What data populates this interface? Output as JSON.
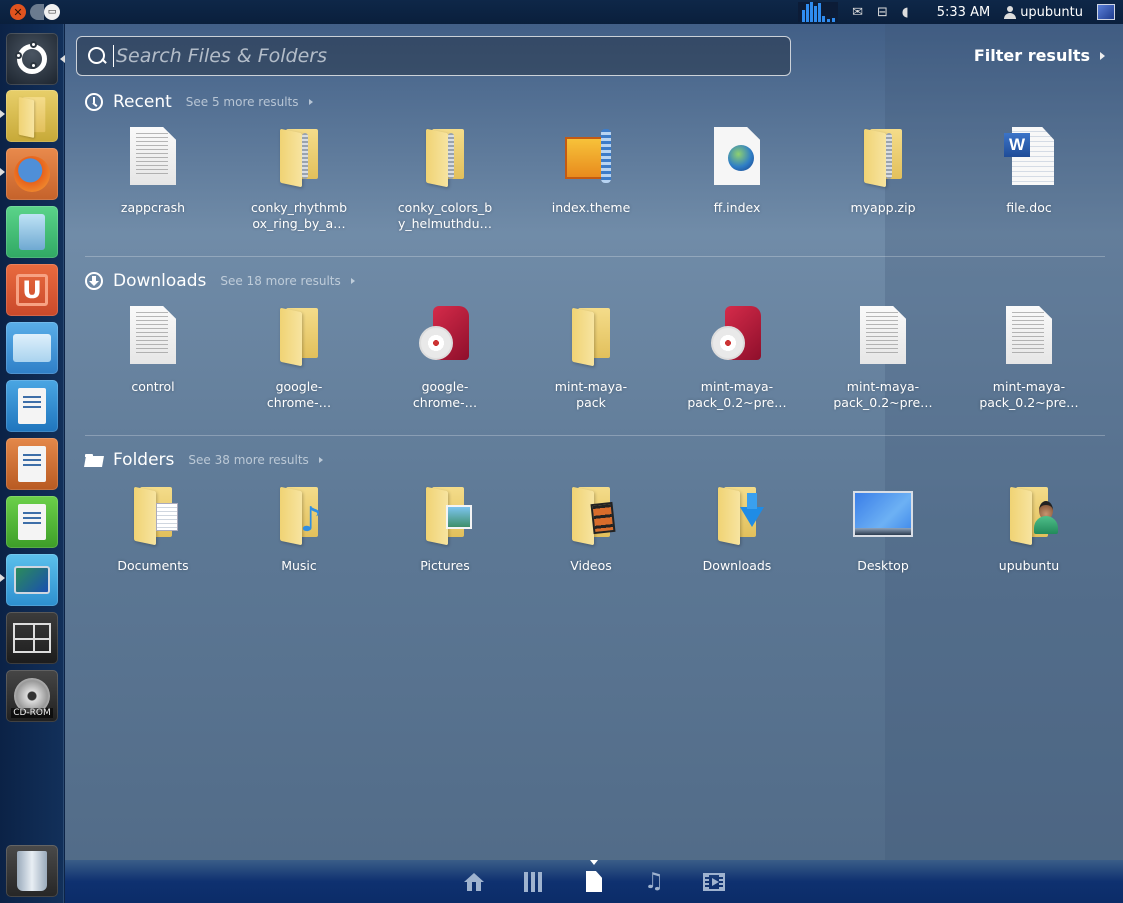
{
  "top_panel": {
    "window_controls": [
      {
        "name": "close",
        "glyph": "✕"
      },
      {
        "name": "minimize",
        "glyph": ""
      },
      {
        "name": "maximize",
        "glyph": "▭"
      }
    ],
    "indicators": [
      {
        "name": "system-monitor-icon"
      },
      {
        "name": "messaging-icon",
        "glyph": "✉"
      },
      {
        "name": "network-icon",
        "glyph": "⊟"
      },
      {
        "name": "volume-icon",
        "glyph": "◖"
      }
    ],
    "clock": "5:33 AM",
    "username": "upubuntu"
  },
  "launcher": {
    "items": [
      {
        "name": "dash-home",
        "tooltip": ""
      },
      {
        "name": "files",
        "running": true
      },
      {
        "name": "firefox",
        "running": true
      },
      {
        "name": "windows-installer"
      },
      {
        "name": "ubuntu-one"
      },
      {
        "name": "control-panel"
      },
      {
        "name": "libreoffice-writer"
      },
      {
        "name": "libreoffice-impress"
      },
      {
        "name": "libreoffice-calc"
      },
      {
        "name": "paint",
        "running": true
      },
      {
        "name": "workspace-switcher"
      },
      {
        "name": "cd-rom",
        "label": "CD-ROM"
      },
      {
        "name": "trash"
      }
    ]
  },
  "search": {
    "placeholder": "Search Files & Folders",
    "value": ""
  },
  "filter_results_label": "Filter results",
  "sections": [
    {
      "title": "Recent",
      "see_more": "See 5 more results",
      "icon": "clock-icon",
      "items": [
        {
          "label": "zappcrash",
          "type": "text-document"
        },
        {
          "label": "conky_rhythmb\nox_ring_by_a…",
          "type": "zip-folder"
        },
        {
          "label": "conky_colors_b\ny_helmuthdu…",
          "type": "zip-folder"
        },
        {
          "label": "index.theme",
          "type": "archiver"
        },
        {
          "label": "ff.index",
          "type": "web-document"
        },
        {
          "label": "myapp.zip",
          "type": "zip-folder"
        },
        {
          "label": "file.doc",
          "type": "word-document"
        }
      ]
    },
    {
      "title": "Downloads",
      "see_more": "See 18 more results",
      "icon": "download-icon",
      "items": [
        {
          "label": "control",
          "type": "text-document"
        },
        {
          "label": "google-\nchrome-…",
          "type": "folder"
        },
        {
          "label": "google-\nchrome-…",
          "type": "deb-package"
        },
        {
          "label": "mint-maya-\npack",
          "type": "folder"
        },
        {
          "label": "mint-maya-\npack_0.2~pre…",
          "type": "deb-package"
        },
        {
          "label": "mint-maya-\npack_0.2~pre…",
          "type": "text-document"
        },
        {
          "label": "mint-maya-\npack_0.2~pre…",
          "type": "text-document"
        }
      ]
    },
    {
      "title": "Folders",
      "see_more": "See 38 more results",
      "icon": "folder-icon",
      "items": [
        {
          "label": "Documents",
          "type": "documents-folder"
        },
        {
          "label": "Music",
          "type": "music-folder"
        },
        {
          "label": "Pictures",
          "type": "pictures-folder"
        },
        {
          "label": "Videos",
          "type": "videos-folder"
        },
        {
          "label": "Downloads",
          "type": "downloads-folder"
        },
        {
          "label": "Desktop",
          "type": "desktop"
        },
        {
          "label": "upubuntu",
          "type": "home-folder"
        }
      ]
    }
  ],
  "lenses": [
    {
      "name": "home",
      "active": false
    },
    {
      "name": "applications",
      "active": false
    },
    {
      "name": "files",
      "active": true
    },
    {
      "name": "music",
      "glyph": "♫",
      "active": false
    },
    {
      "name": "video",
      "active": false
    }
  ]
}
